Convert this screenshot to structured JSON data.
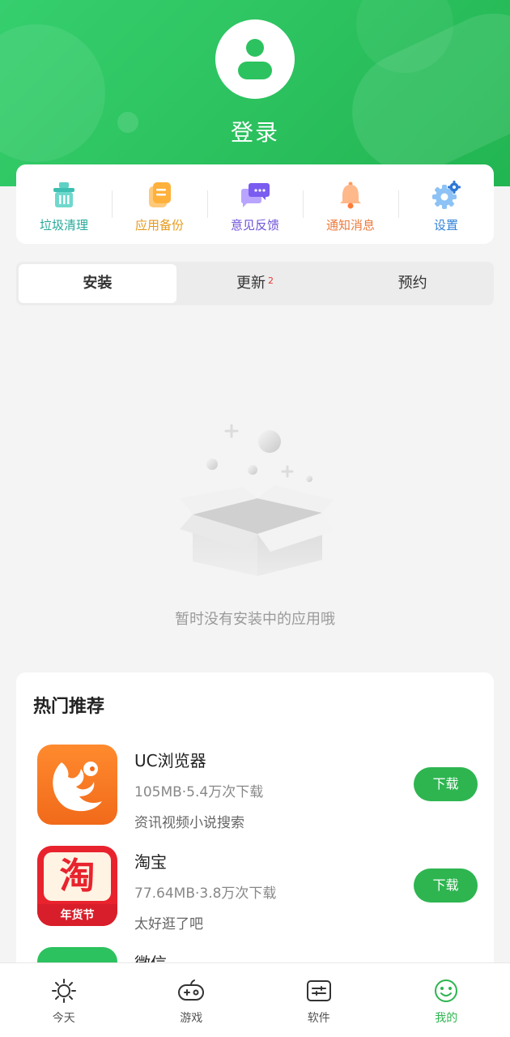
{
  "header": {
    "login_label": "登录"
  },
  "tools": [
    {
      "label": "垃圾清理",
      "icon": "trash-clean-icon",
      "color": "#27a99b"
    },
    {
      "label": "应用备份",
      "icon": "backup-icon",
      "color": "#e69a1d"
    },
    {
      "label": "意见反馈",
      "icon": "feedback-icon",
      "color": "#6f52d8"
    },
    {
      "label": "通知消息",
      "icon": "bell-icon",
      "color": "#ec7a3d"
    },
    {
      "label": "设置",
      "icon": "gear-icon",
      "color": "#3483d9"
    }
  ],
  "tabs": [
    {
      "label": "安装",
      "active": true
    },
    {
      "label": "更新",
      "badge": "2"
    },
    {
      "label": "预约"
    }
  ],
  "empty_state": {
    "text": "暂时没有安装中的应用哦"
  },
  "recommend": {
    "title": "热门推荐",
    "apps": [
      {
        "name": "UC浏览器",
        "meta": "105MB·5.4万次下载",
        "desc": "资讯视频小说搜索",
        "button": "下载",
        "icon": "uc-browser-icon"
      },
      {
        "name": "淘宝",
        "meta": "77.64MB·3.8万次下载",
        "desc": "太好逛了吧",
        "button": "下载",
        "icon": "taobao-icon",
        "icon_text": "淘",
        "icon_banner": "年货节"
      },
      {
        "name": "微信",
        "icon": "wechat-icon"
      }
    ]
  },
  "bottom_nav": [
    {
      "label": "今天",
      "icon": "sun-icon"
    },
    {
      "label": "游戏",
      "icon": "gamepad-icon"
    },
    {
      "label": "软件",
      "icon": "software-icon"
    },
    {
      "label": "我的",
      "icon": "smile-icon",
      "active": true
    }
  ],
  "colors": {
    "brand_green": "#2cc25f",
    "download_button": "#2eb550",
    "badge_red": "#e53935"
  }
}
